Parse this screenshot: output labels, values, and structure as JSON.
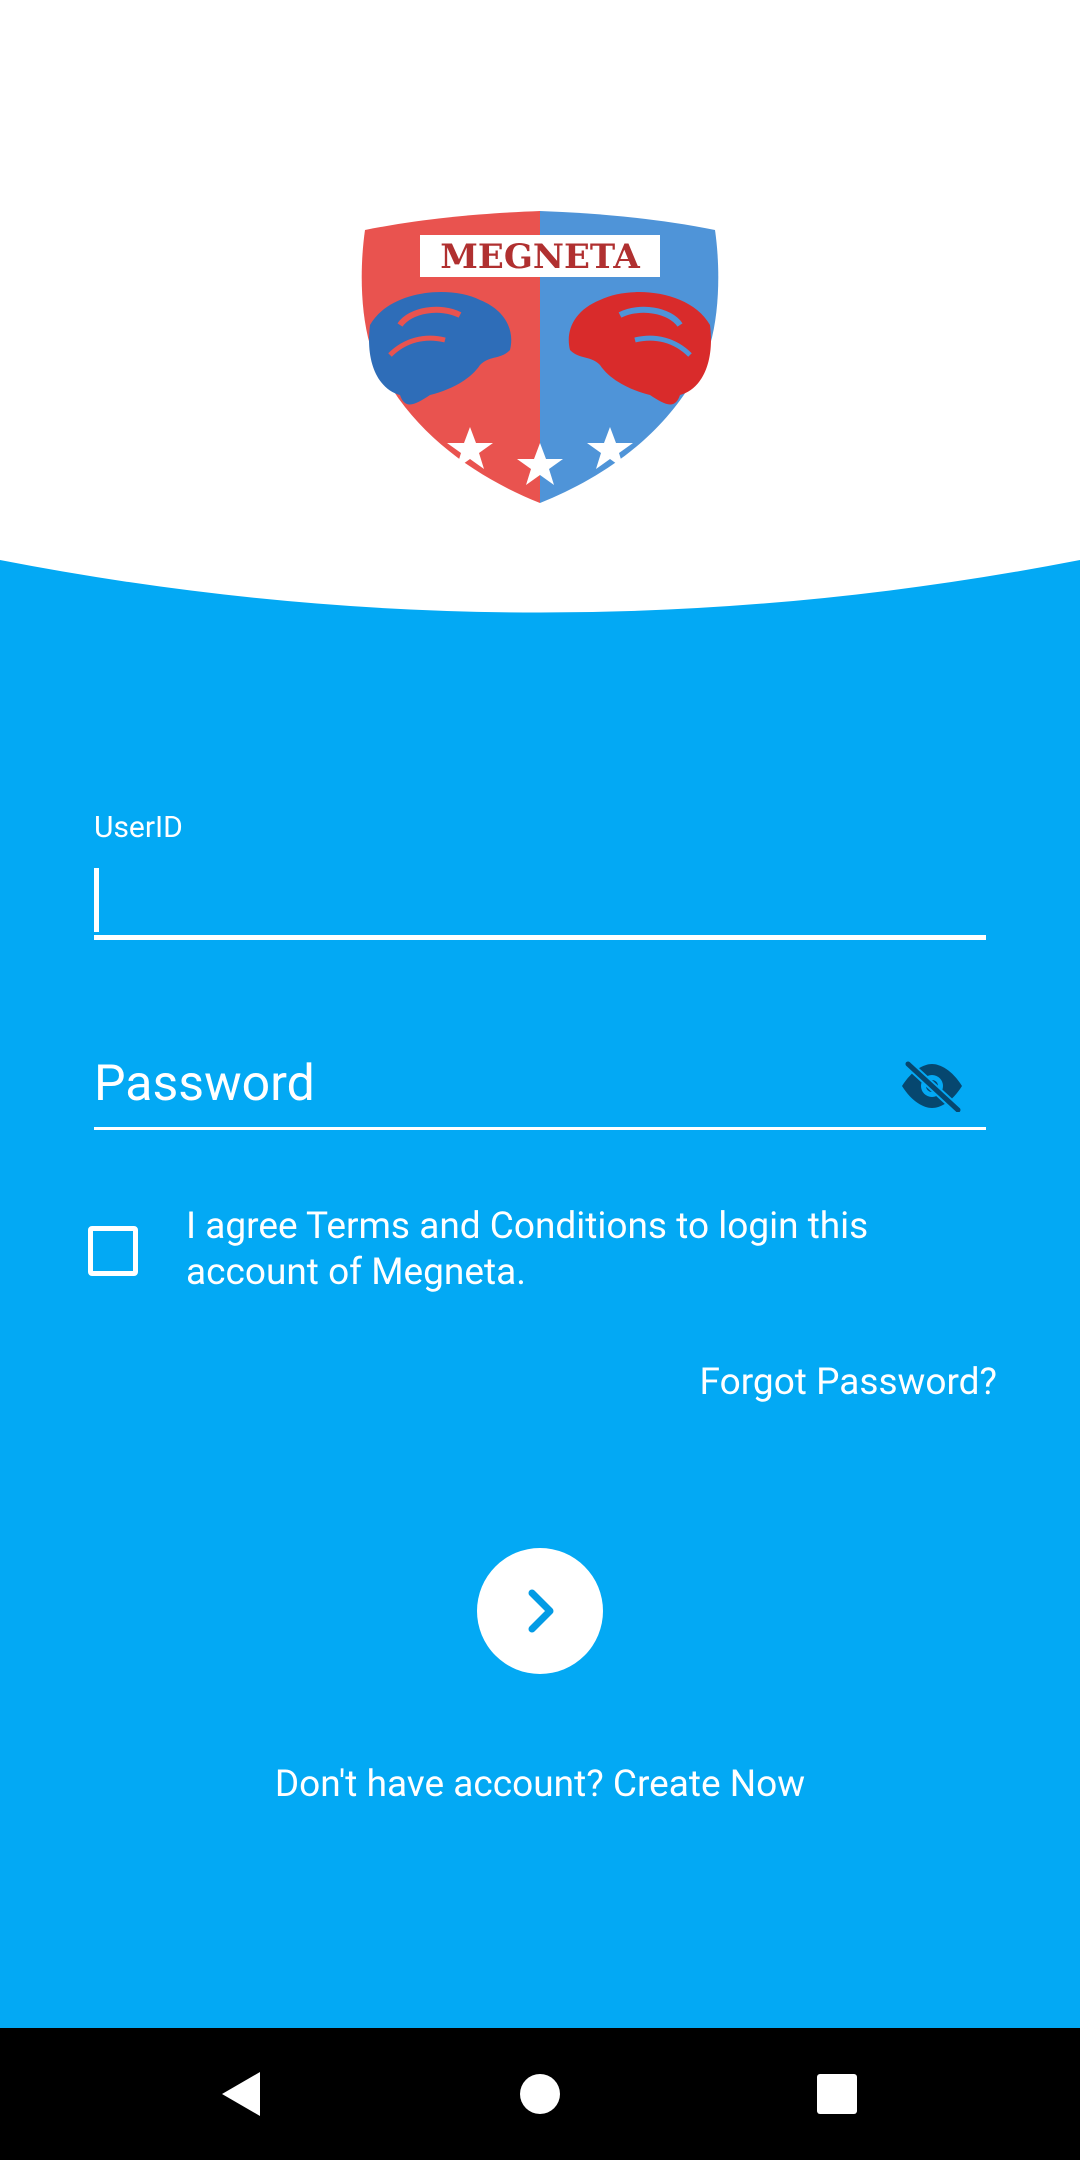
{
  "brand": {
    "logo_text": "MEGNETA",
    "logo_red": "#e9534f",
    "logo_blue": "#4f94d8"
  },
  "colors": {
    "background": "#03a9f4",
    "top": "#ffffff",
    "eye_icon": "#06476f",
    "nav_bar": "#000000"
  },
  "form": {
    "userid_label": "UserID",
    "userid_value": "",
    "password_placeholder": "Password",
    "password_visibility_icon": "eye-off-icon",
    "terms_checked": false,
    "terms_text": "I agree Terms and Conditions to login this account of Megneta.",
    "forgot_password": "Forgot Password?",
    "submit_icon": "chevron-right-icon",
    "create_account": "Don't have account? Create Now"
  },
  "navigation": {
    "back_icon": "back-triangle-icon",
    "home_icon": "home-circle-icon",
    "recents_icon": "recents-square-icon"
  }
}
